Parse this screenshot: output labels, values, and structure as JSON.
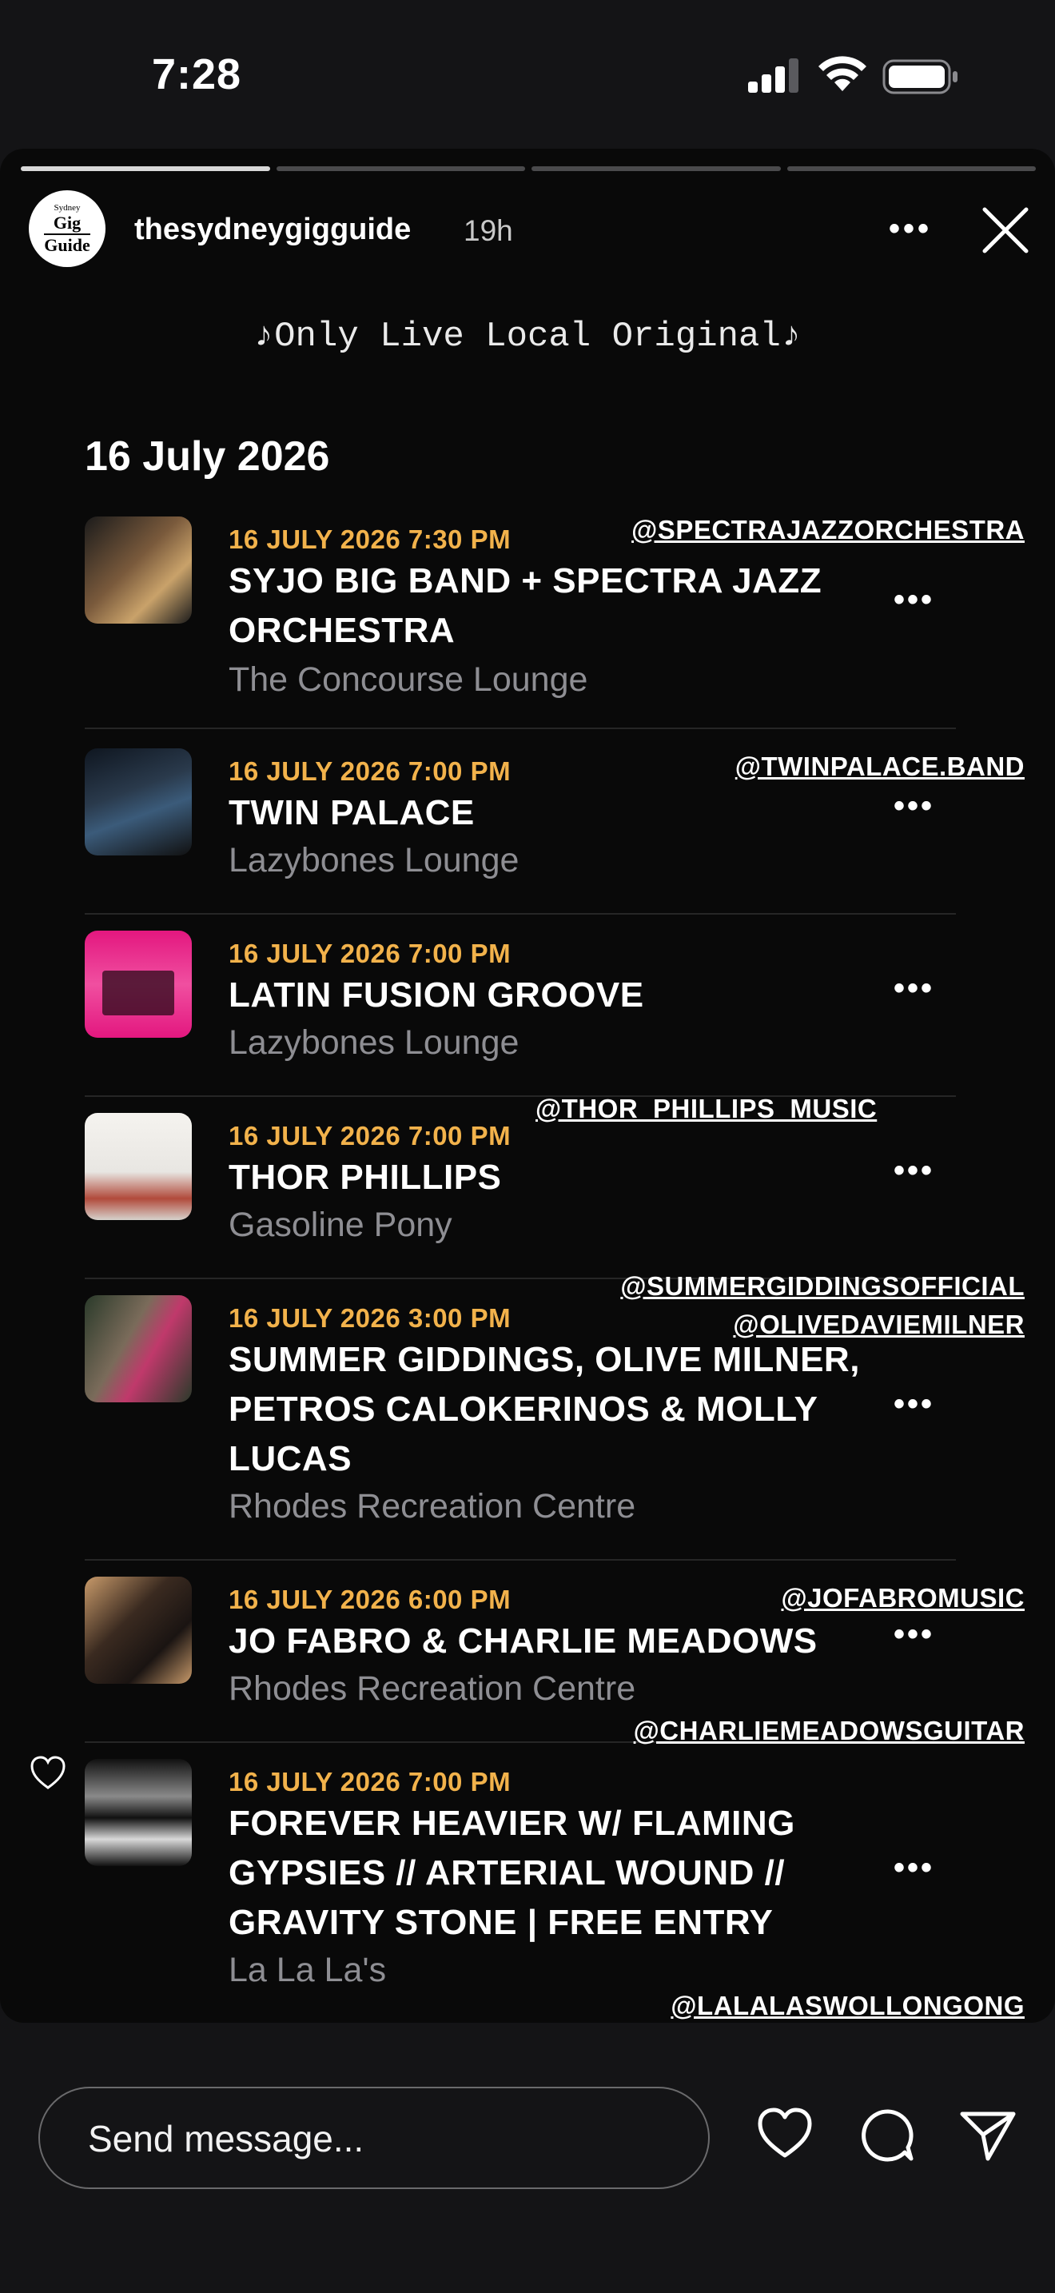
{
  "status_bar": {
    "time": "7:28"
  },
  "story": {
    "username": "thesydneygigguide",
    "age": "19h",
    "avatar_lines": [
      "Sydney",
      "Gig",
      "Guide"
    ],
    "progress_segments": 4,
    "progress_completed": 1,
    "tagline": "♪Only Live Local Original♪",
    "date_heading": "16 July 2026",
    "events": [
      {
        "datetime": "16 JULY 2026 7:30 PM",
        "title_lines": [
          "SYJO BIG BAND + SPECTRA JAZZ",
          "ORCHESTRA"
        ],
        "venue": "The Concourse Lounge",
        "handles": [
          "@SPECTRAJAZZORCHESTRA"
        ],
        "thumb_colors": [
          "#1b1b1b",
          "#7a5a3c",
          "#c9a26a"
        ]
      },
      {
        "datetime": "16 JULY 2026 7:00 PM",
        "title_lines": [
          "TWIN PALACE"
        ],
        "venue": "Lazybones Lounge",
        "handles": [
          "@TWINPALACE.BAND"
        ],
        "thumb_colors": [
          "#0f1620",
          "#3b5b7a",
          "#1a1a1a"
        ]
      },
      {
        "datetime": "16 JULY 2026 7:00 PM",
        "title_lines": [
          "LATIN FUSION GROOVE"
        ],
        "venue": "Lazybones Lounge",
        "handles": [],
        "thumb_colors": [
          "#e3177f",
          "#f04fa0",
          "#2a0a18"
        ]
      },
      {
        "datetime": "16 JULY 2026 7:00 PM",
        "title_lines": [
          "THOR PHILLIPS"
        ],
        "venue": "Gasoline Pony",
        "handles": [
          "@THOR_PHILLIPS_MUSIC"
        ],
        "thumb_colors": [
          "#e8e6e2",
          "#b14a3b",
          "#f5f3ef"
        ]
      },
      {
        "datetime": "16 JULY 2026 3:00 PM",
        "title_lines": [
          "SUMMER GIDDINGS, OLIVE MILNER,",
          "PETROS CALOKERINOS & MOLLY",
          "LUCAS"
        ],
        "venue": "Rhodes Recreation Centre",
        "handles": [
          "@SUMMERGIDDINGSOFFICIAL",
          "@OLIVEDAVIEMILNER"
        ],
        "thumb_colors": [
          "#2a3a2a",
          "#c0396b",
          "#7a6b5a"
        ]
      },
      {
        "datetime": "16 JULY 2026 6:00 PM",
        "title_lines": [
          "JO FABRO & CHARLIE MEADOWS"
        ],
        "venue": "Rhodes Recreation Centre",
        "handles": [
          "@JOFABROMUSIC",
          "@CHARLIEMEADOWSGUITAR"
        ],
        "thumb_colors": [
          "#3a2a20",
          "#c89a6a",
          "#1a1412"
        ]
      },
      {
        "datetime": "16 JULY 2026 7:00 PM",
        "title_lines": [
          "FOREVER HEAVIER W/ FLAMING",
          "GYPSIES // ARTERIAL WOUND //",
          "GRAVITY STONE | FREE ENTRY"
        ],
        "venue": "La La La's",
        "handles": [
          "@LALALASWOLLONGONG"
        ],
        "thumb_colors": [
          "#111111",
          "#8a8a8a",
          "#d9d9d9"
        ]
      }
    ]
  },
  "bottom_bar": {
    "message_placeholder": "Send message..."
  }
}
